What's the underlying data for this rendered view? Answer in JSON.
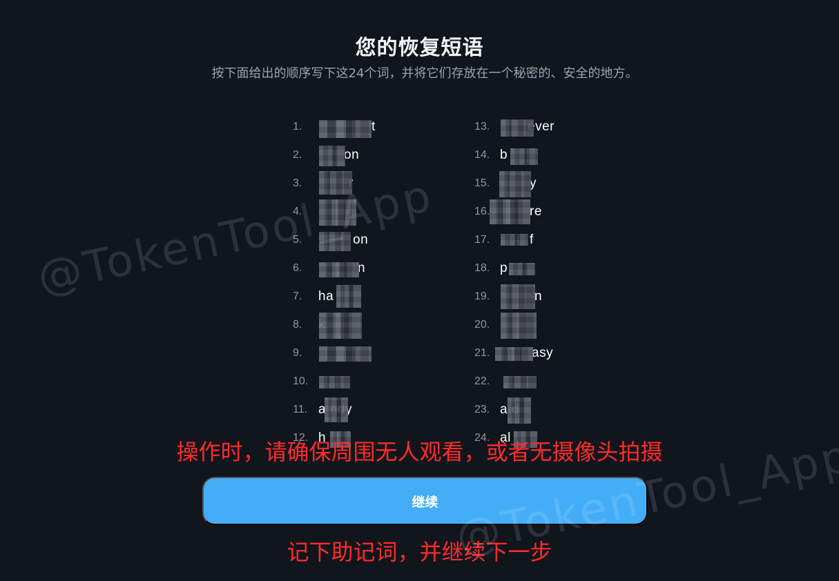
{
  "header": {
    "title": "您的恢复短语",
    "subtitle": "按下面给出的顺序写下这24个词，并将它们存放在一个秘密的、安全的地方。"
  },
  "phrase": {
    "left": [
      {
        "number": "1.",
        "text": "t"
      },
      {
        "number": "2.",
        "text": "on"
      },
      {
        "number": "3.",
        "text": "r"
      },
      {
        "number": "4.",
        "text": ""
      },
      {
        "number": "5.",
        "text": "on"
      },
      {
        "number": "6.",
        "text": "n"
      },
      {
        "number": "7.",
        "text": "ha"
      },
      {
        "number": "8.",
        "text": "k"
      },
      {
        "number": "9.",
        "text": ""
      },
      {
        "number": "10.",
        "text": ""
      },
      {
        "number": "11.",
        "text": "a ndy"
      },
      {
        "number": "12.",
        "text": "h"
      }
    ],
    "right": [
      {
        "number": "13.",
        "text": "ever"
      },
      {
        "number": "14.",
        "text": "b"
      },
      {
        "number": "15.",
        "text": "y"
      },
      {
        "number": "16.",
        "text": "re"
      },
      {
        "number": "17.",
        "text": "f"
      },
      {
        "number": "18.",
        "text": "p"
      },
      {
        "number": "19.",
        "text": "n"
      },
      {
        "number": "20.",
        "text": ""
      },
      {
        "number": "21.",
        "text": "asy"
      },
      {
        "number": "22.",
        "text": ""
      },
      {
        "number": "23.",
        "text": "a d"
      },
      {
        "number": "24.",
        "text": "al"
      }
    ]
  },
  "notices": {
    "warning": "操作时，请确保周围无人观看，或者无摄像头拍摄",
    "next_step": "记下助记词，并继续下一步"
  },
  "actions": {
    "continue_label": "继续"
  },
  "watermarks": [
    "@TokenTool_App",
    "@TokenTool_App"
  ],
  "colors": {
    "background": "#11151c",
    "primary_button": "#44adf7",
    "warning_text": "#ff2b2b",
    "muted_text": "#9aa3b1"
  }
}
